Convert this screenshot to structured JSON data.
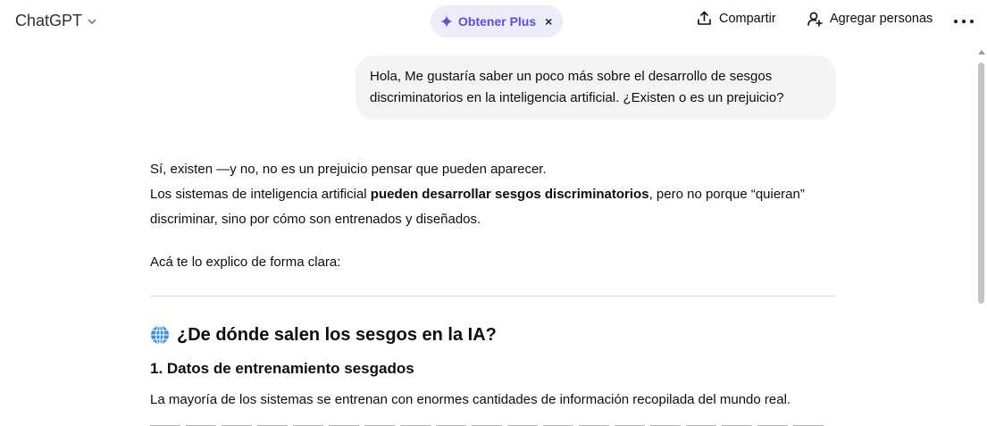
{
  "header": {
    "model_name": "ChatGPT",
    "plus_label": "Obtener Plus",
    "plus_close": "×",
    "share_label": "Compartir",
    "add_people_label": "Agregar personas",
    "plus_color": "#5b4fdb"
  },
  "icons": {
    "model": "chevron-down-icon",
    "plus": "sparkle-icon",
    "close": "close-icon",
    "share": "share-icon",
    "add_people": "add-user-icon",
    "more": "more-horizontal-icon",
    "heading": "globe-icon"
  },
  "conversation": {
    "user_message": "Hola, Me gustaría saber un poco más sobre el desarrollo de sesgos discriminatorios en la inteligencia artificial. ¿Existen o es un prejuicio?",
    "assistant": {
      "line1": "Sí, existen —y no, no es un prejuicio pensar que pueden aparecer.",
      "line2_pre": "Los sistemas de inteligencia artificial ",
      "line2_bold": "pueden desarrollar sesgos discriminatorios",
      "line2_post": ", pero no porque “quieran” discriminar, sino por cómo son entrenados y diseñados.",
      "intro": "Acá te lo explico de forma clara:",
      "heading": "¿De dónde salen los sesgos en la IA?",
      "subheading": "1. Datos de entrenamiento sesgados",
      "paragraph": "La mayoría de los sistemas se entrenan con enormes cantidades de información recopilada del mundo real."
    }
  }
}
